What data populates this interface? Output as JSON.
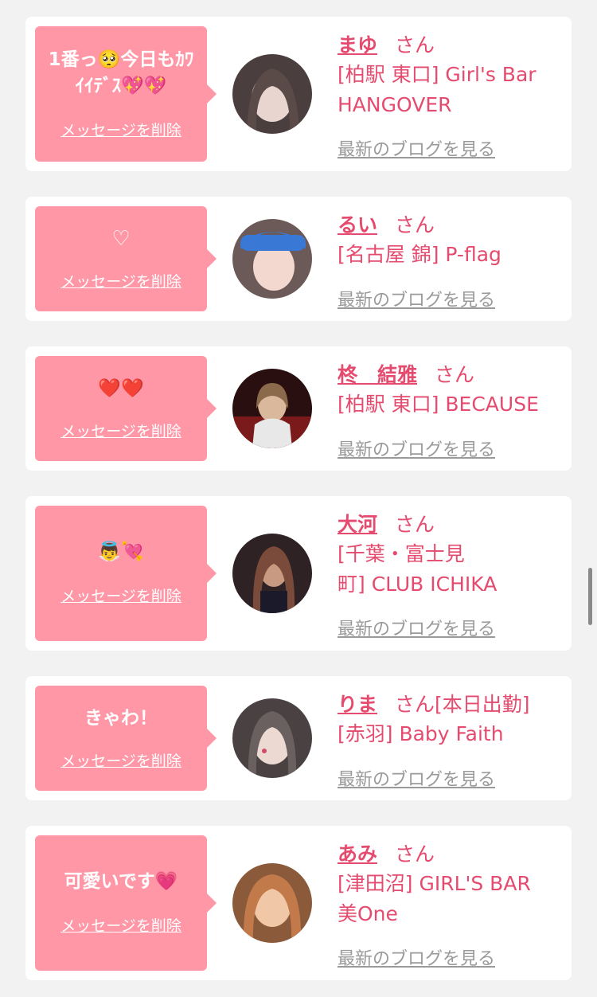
{
  "common": {
    "delete_label": "メッセージを削除",
    "san": "さん",
    "blog_link": "最新のブログを見る"
  },
  "entries": [
    {
      "message": "1番っ🥺今日もｶﾜｲｲﾃﾞｽ💖💖",
      "message_line1": "1番っ🥺今日もｶﾜ",
      "message_line2": "ｲｲﾃﾞｽ💖💖",
      "name": "まゆ",
      "suffix": "",
      "shop_line1": "[柏駅 東口] Girl's Bar",
      "shop_line2": "HANGOVER",
      "avatar_colors": [
        "#5a4a48",
        "#e8d5cf"
      ]
    },
    {
      "message": "♡",
      "name": "るい",
      "suffix": "",
      "shop_line1": "[名古屋 錦] P-flag",
      "shop_line2": "",
      "avatar_colors": [
        "#3a78d6",
        "#f2d8cf"
      ]
    },
    {
      "message": "❤️❤️",
      "name": "柊　結雅",
      "suffix": "",
      "shop_line1": "[柏駅 東口] BECAUSE",
      "shop_line2": "",
      "avatar_colors": [
        "#4a1a1a",
        "#d9b89c"
      ]
    },
    {
      "message": "👼💘",
      "name": "大河",
      "suffix": "",
      "shop_line1": "[千葉・富士見",
      "shop_line2": "町] CLUB ICHIKA",
      "avatar_colors": [
        "#3a2a2e",
        "#c89a82"
      ]
    },
    {
      "message": "きゃわ！",
      "name": "りま",
      "suffix": "[本日出勤]",
      "shop_line1": "[赤羽] Baby Faith",
      "shop_line2": "",
      "avatar_colors": [
        "#6a6060",
        "#ecd9d2"
      ]
    },
    {
      "message": "可愛いです💗",
      "name": "あみ",
      "suffix": "",
      "shop_line1": "[津田沼] GIRL'S BAR",
      "shop_line2": "美One",
      "avatar_colors": [
        "#c27a4a",
        "#f0c8a8"
      ]
    }
  ]
}
